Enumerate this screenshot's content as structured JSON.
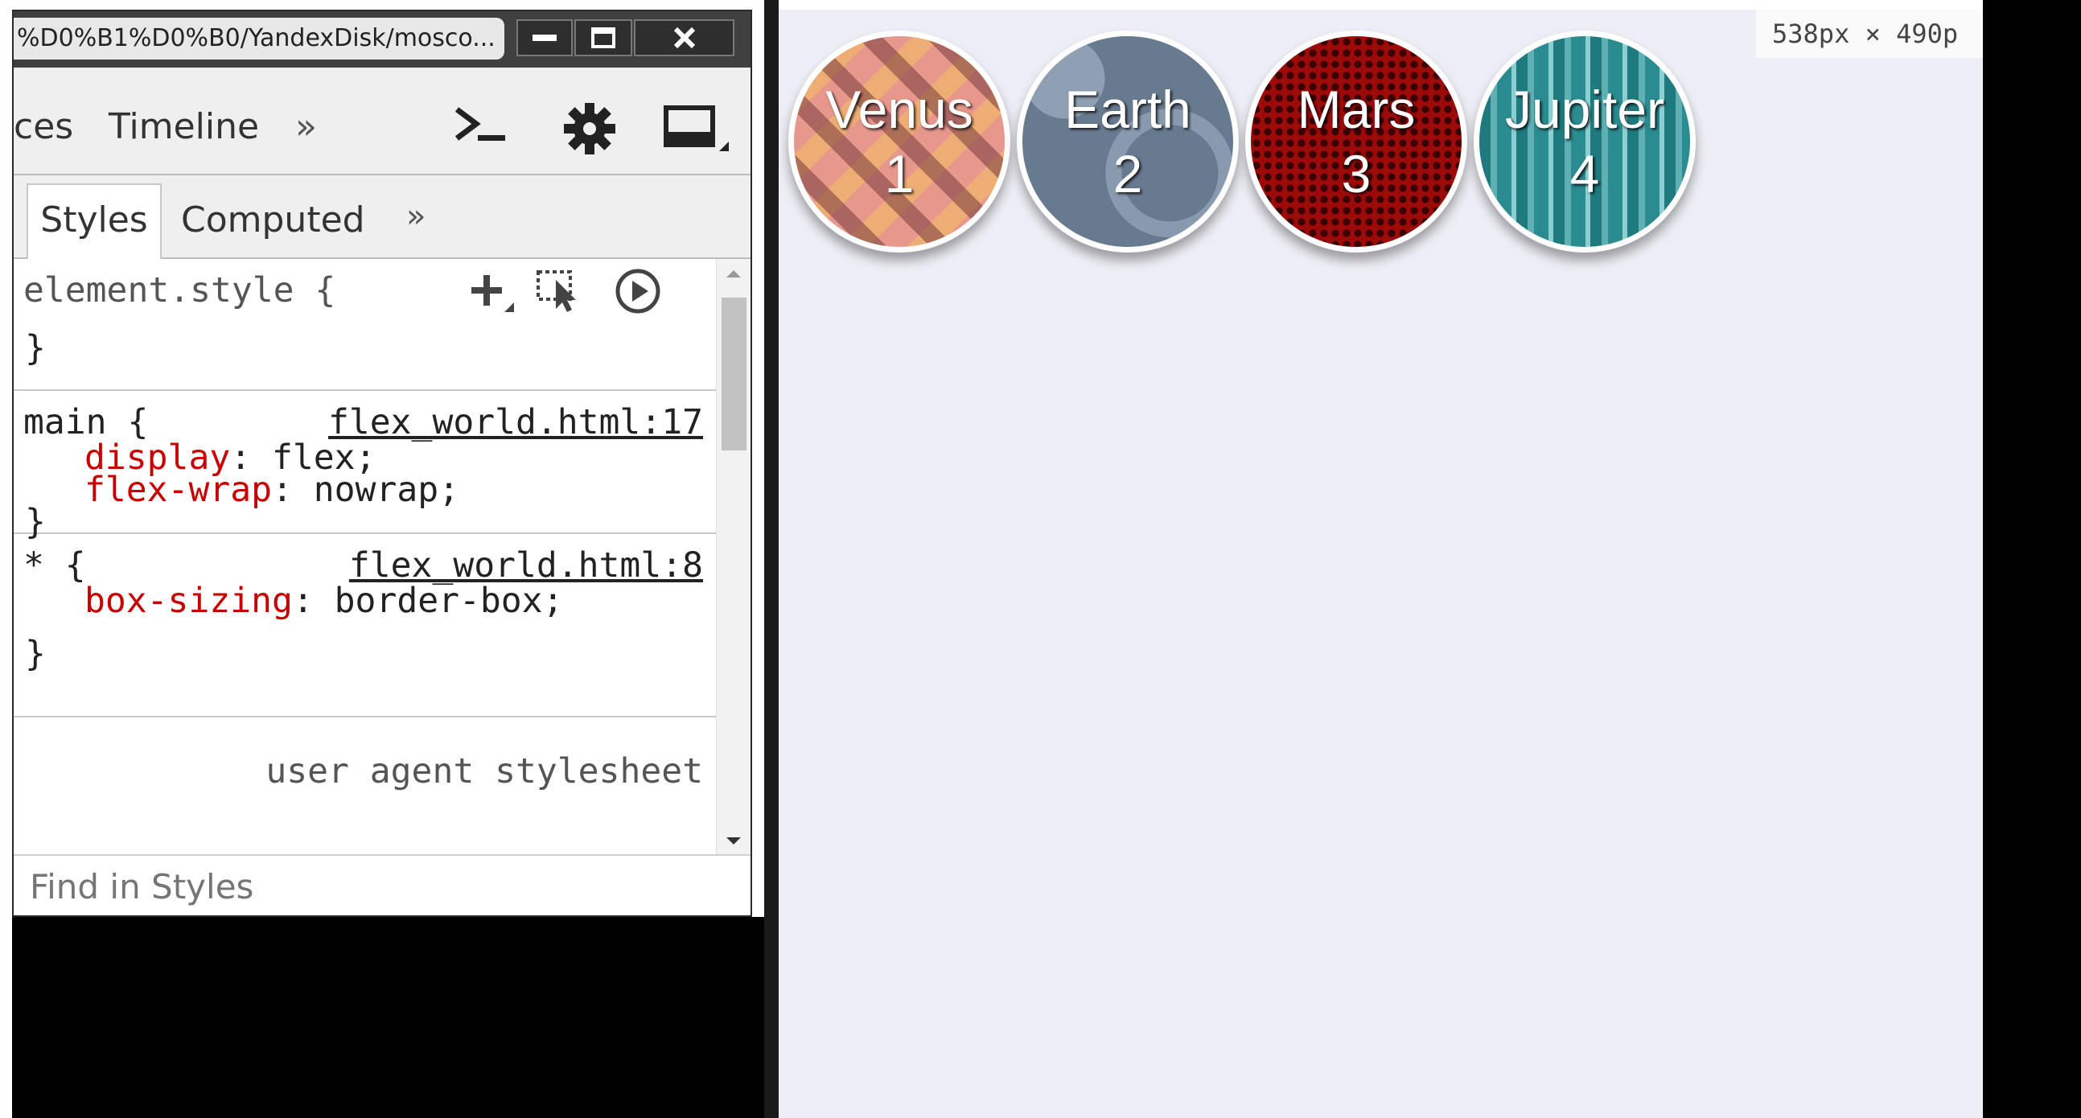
{
  "window": {
    "title": "%D0%B1%D0%B0/YandexDisk/mosco..."
  },
  "toolbar": {
    "tabs": [
      "ces",
      "Timeline"
    ],
    "more": "»"
  },
  "sidebar_tabs": {
    "styles": "Styles",
    "computed": "Computed",
    "more": "»"
  },
  "rules": {
    "element_style": {
      "selector": "element.style {",
      "close": "}"
    },
    "main": {
      "selector": "main {",
      "source": "flex_world.html:17",
      "props": [
        {
          "name": "display",
          "value": ": flex;"
        },
        {
          "name": "flex-wrap",
          "value": ": nowrap;"
        }
      ],
      "close": "}"
    },
    "universal": {
      "selector": "* {",
      "source": "flex_world.html:8",
      "props": [
        {
          "name": "box-sizing",
          "value": ": border-box;"
        }
      ],
      "close": "}"
    },
    "user_agent": {
      "label": "user agent stylesheet"
    }
  },
  "find": {
    "placeholder": "Find in Styles"
  },
  "viewport": {
    "dimensions": "538px × 490p",
    "planets": [
      {
        "name": "Venus",
        "number": "1"
      },
      {
        "name": "Earth",
        "number": "2"
      },
      {
        "name": "Mars",
        "number": "3"
      },
      {
        "name": "Jupiter",
        "number": "4"
      }
    ]
  },
  "icons": [
    "console-icon",
    "gear-icon",
    "dock-icon",
    "add-rule-icon",
    "element-state-icon",
    "animations-icon",
    "minimize-icon",
    "maximize-icon",
    "close-icon"
  ]
}
